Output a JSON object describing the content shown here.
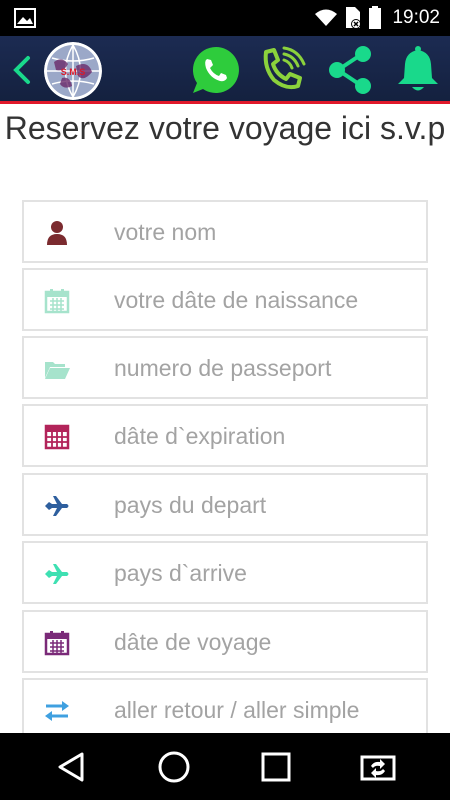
{
  "status_bar": {
    "time": "19:02",
    "icons": [
      "gallery-icon",
      "wifi-icon",
      "sim-error-icon",
      "battery-icon"
    ]
  },
  "app_bar": {
    "logo_text": "S.M.S",
    "actions": [
      "whatsapp-icon",
      "phone-call-icon",
      "share-icon",
      "bell-icon"
    ],
    "colors": {
      "bar": "#1c2b52",
      "accent_line": "#e0182a",
      "icons": "#19d98b",
      "whatsapp": "#2ecc3c"
    }
  },
  "page": {
    "title": "Reservez votre voyage ici s.v.p"
  },
  "form": {
    "fields": [
      {
        "placeholder": "votre nom",
        "icon": "user-icon",
        "color": "#7b2b2f"
      },
      {
        "placeholder": "votre dâte de naissance",
        "icon": "calendar-icon",
        "color": "#a6e3cc"
      },
      {
        "placeholder": "numero de passeport",
        "icon": "folder-open-icon",
        "color": "#a6e3cc"
      },
      {
        "placeholder": "dâte d`expiration",
        "icon": "calculator-icon",
        "color": "#b2245a"
      },
      {
        "placeholder": "pays du depart",
        "icon": "plane-icon",
        "color": "#2e5f9e"
      },
      {
        "placeholder": "pays d`arrive",
        "icon": "plane-icon",
        "color": "#3ee0b2"
      },
      {
        "placeholder": "dâte de voyage",
        "icon": "calendar-icon",
        "color": "#7a2a78"
      },
      {
        "placeholder": "aller retour / aller simple",
        "icon": "exchange-icon",
        "color": "#3fa0e0"
      }
    ]
  },
  "nav_bar": {
    "buttons": [
      "back-triangle-icon",
      "home-circle-icon",
      "recents-square-icon",
      "rotate-screen-icon"
    ]
  }
}
